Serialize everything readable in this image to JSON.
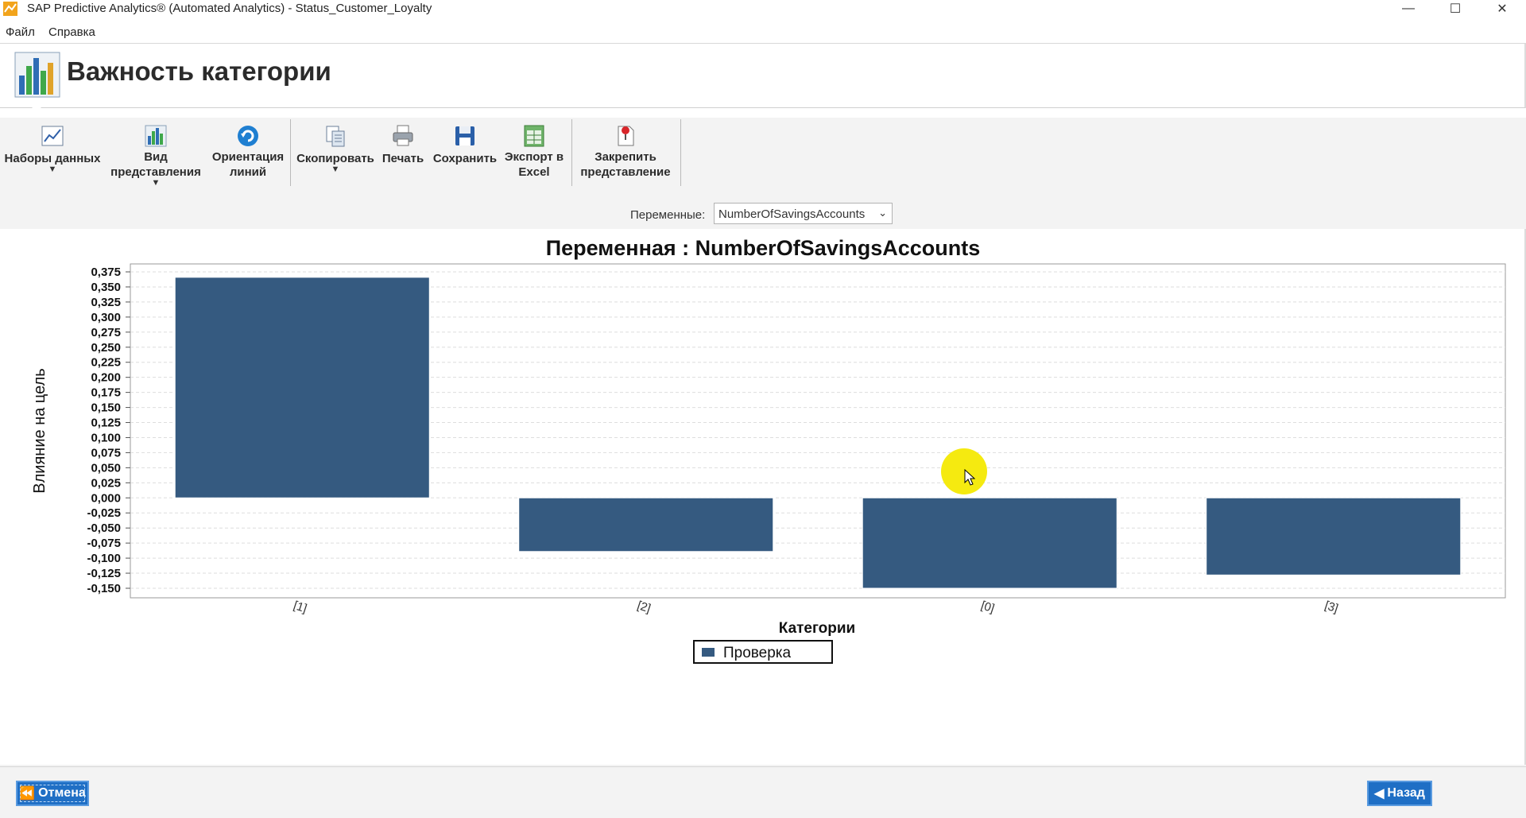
{
  "window": {
    "title": "SAP Predictive Analytics® (Automated Analytics) - Status_Customer_Loyalty",
    "minimize_glyph": "—",
    "maximize_glyph": "☐",
    "close_glyph": "✕"
  },
  "menu": {
    "items": [
      "Файл",
      "Справка"
    ]
  },
  "header": {
    "title": "Важность категории",
    "icon": "bar-chart-app-icon"
  },
  "toolbar": {
    "buttons": [
      {
        "label1": "Наборы данных",
        "label2": "",
        "icon": "line-chart-icon",
        "dropdown": true
      },
      {
        "label1": "Вид",
        "label2": "представления",
        "icon": "bar-chart-icon",
        "dropdown": true
      },
      {
        "label1": "Ориентация",
        "label2": "линий",
        "icon": "rotate-icon",
        "dropdown": false
      },
      {
        "label1": "Скопировать",
        "label2": "",
        "icon": "copy-icon",
        "dropdown": true
      },
      {
        "label1": "Печать",
        "label2": "",
        "icon": "printer-icon",
        "dropdown": false
      },
      {
        "label1": "Сохранить",
        "label2": "",
        "icon": "save-icon",
        "dropdown": false
      },
      {
        "label1": "Экспорт в",
        "label2": "Excel",
        "icon": "excel-export-icon",
        "dropdown": false
      },
      {
        "label1": "Закрепить",
        "label2": "представление",
        "icon": "pin-view-icon",
        "dropdown": false
      }
    ]
  },
  "variables": {
    "label": "Переменные:",
    "selected": "NumberOfSavingsAccounts"
  },
  "chart_data": {
    "type": "bar",
    "title": "Переменная : NumberOfSavingsAccounts",
    "xlabel": "Категории",
    "ylabel": "Влияние на цель",
    "categories": [
      "[1]",
      "[2]",
      "[0]",
      "[3]"
    ],
    "series": [
      {
        "name": "Проверка",
        "values": [
          0.366,
          -0.089,
          -0.15,
          -0.128
        ],
        "color": "#355a80"
      }
    ],
    "ylim": [
      -0.15,
      0.375
    ],
    "yticks": [
      "0,375",
      "0,350",
      "0,325",
      "0,300",
      "0,275",
      "0,250",
      "0,225",
      "0,200",
      "0,175",
      "0,150",
      "0,125",
      "0,100",
      "0,075",
      "0,050",
      "0,025",
      "0,000",
      "-0,025",
      "-0,050",
      "-0,075",
      "-0,100",
      "-0,125",
      "-0,150"
    ],
    "grid": true,
    "legend": "bottom-center"
  },
  "footer": {
    "cancel_label": "Отмена",
    "back_label": "Назад"
  },
  "colors": {
    "accent": "#1f6fc5",
    "bar": "#355a80",
    "toolbar_bg": "#f3f3f3"
  }
}
